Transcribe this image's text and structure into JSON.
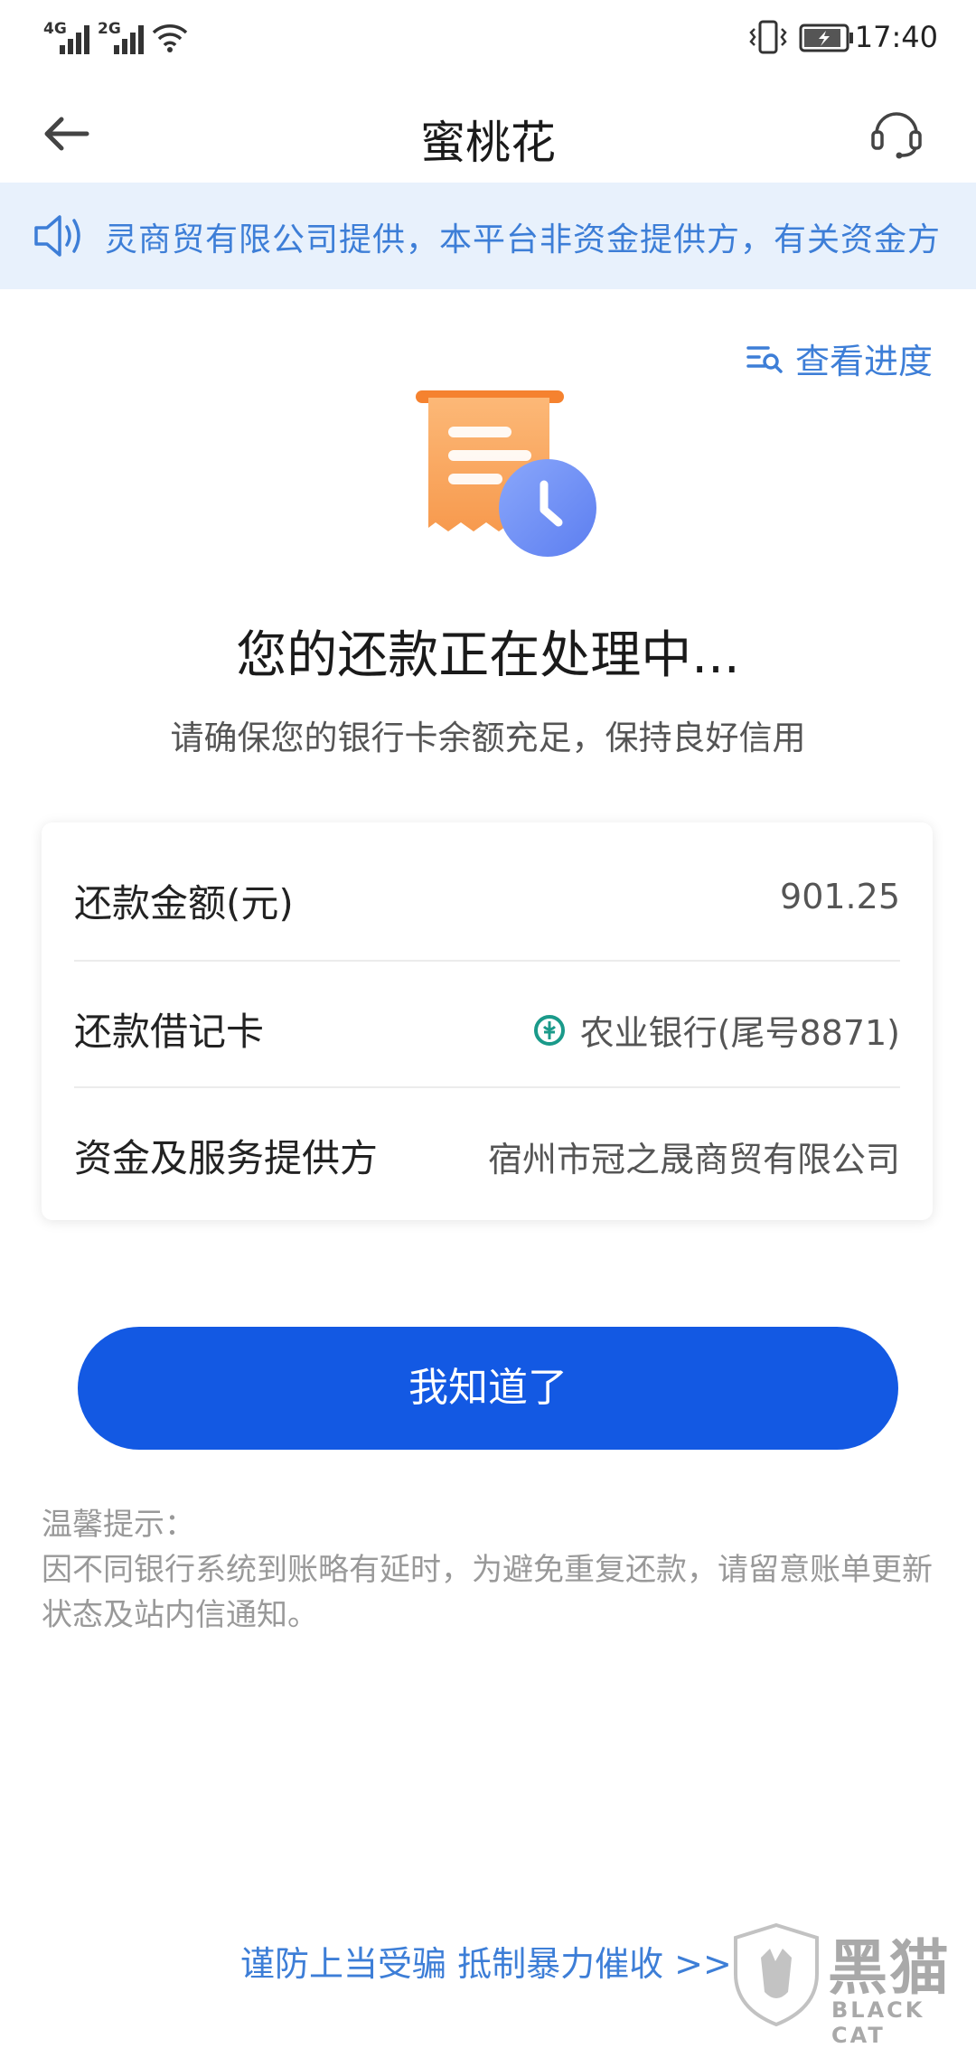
{
  "status_bar": {
    "network_1": "4G",
    "network_2": "2G",
    "time": "17:40"
  },
  "header": {
    "title": "蜜桃花"
  },
  "notice": {
    "text": "灵商贸有限公司提供，本平台非资金提供方，有关资金方"
  },
  "progress_link": "查看进度",
  "status": {
    "headline": "您的还款正在处理中...",
    "subline": "请确保您的银行卡余额充足，保持良好信用"
  },
  "details": {
    "rows": [
      {
        "label": "还款金额(元)",
        "value": "901.25"
      },
      {
        "label": "还款借记卡",
        "value": "农业银行(尾号8871)"
      },
      {
        "label": "资金及服务提供方",
        "value": "宿州市冠之晟商贸有限公司"
      }
    ]
  },
  "confirm_button": "我知道了",
  "tips": {
    "title": "温馨提示：",
    "body": "因不同银行系统到账略有延时，为避免重复还款，请留意账单更新状态及站内信通知。"
  },
  "footer": {
    "link": "谨防上当受骗 抵制暴力催收 >>"
  },
  "watermark": {
    "cn": "黑猫",
    "en": "BLACK CAT"
  },
  "colors": {
    "accent": "#1359e3",
    "link": "#3d7ed7",
    "notice_bg": "#e8f1fc",
    "receipt": "#f9a35a",
    "clock": "#6b8df4"
  },
  "icons": [
    "back-arrow-icon",
    "headset-icon",
    "speaker-icon",
    "search-list-icon",
    "receipt-clock-icon",
    "abc-bank-logo-icon"
  ]
}
